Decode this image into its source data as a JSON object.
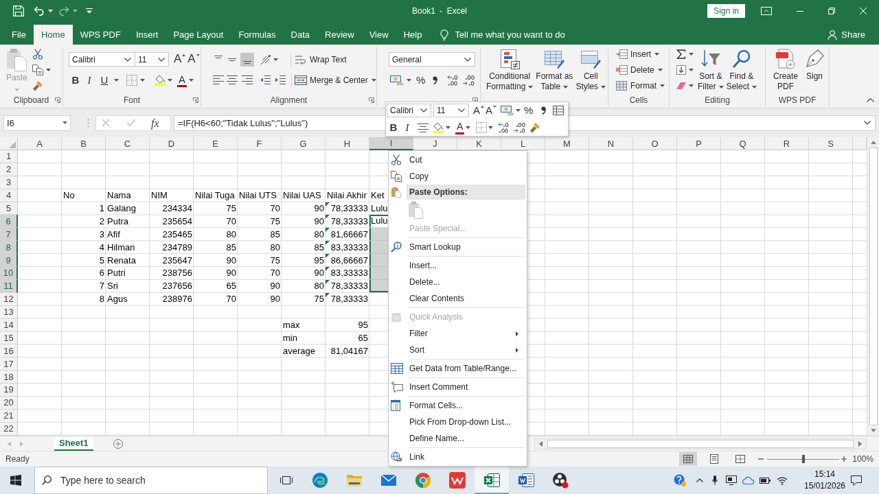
{
  "title_bar": {
    "quick_access": [
      {
        "disabled": false
      },
      {
        "disabled": false
      },
      {
        "disabled": true
      },
      {
        "disabled": false
      }
    ],
    "title": "Book1 - Excel",
    "sign_in": "Sign in"
  },
  "ribbon_tabs": [
    {
      "label": "File",
      "selected": false
    },
    {
      "label": "Home",
      "selected": true
    },
    {
      "label": "WPS PDF",
      "selected": false
    },
    {
      "label": "Insert",
      "selected": false
    },
    {
      "label": "Page Layout",
      "selected": false
    },
    {
      "label": "Formulas",
      "selected": false
    },
    {
      "label": "Data",
      "selected": false
    },
    {
      "label": "Review",
      "selected": false
    },
    {
      "label": "View",
      "selected": false
    },
    {
      "label": "Help",
      "selected": false
    }
  ],
  "tell_me": "Tell me what you want to do",
  "share": "Share",
  "clipboard": {
    "label": "Clipboard",
    "paste": "Paste",
    "paste_disabled": true
  },
  "font": {
    "label": "Font",
    "name": "Calibri",
    "size": "11",
    "grow": "A",
    "shrink": "A",
    "styles": [
      "B",
      "I",
      "U"
    ],
    "font_color": "A"
  },
  "alignment": {
    "label": "Alignment",
    "vertical": [
      {
        "selected": false
      },
      {
        "selected": false
      },
      {
        "selected": true
      }
    ],
    "wrap_text": "Wrap Text",
    "merge": "Merge & Center"
  },
  "number": {
    "format": "General",
    "percent": "%"
  },
  "styles": {
    "buttons": [
      "Conditional Formatting",
      "Format as Table",
      "Cell Styles"
    ]
  },
  "cells": {
    "label": "Cells",
    "buttons": [
      "Insert",
      "Delete",
      "Format"
    ]
  },
  "editing": {
    "label": "Editing",
    "buttons": [
      "Sort & Filter",
      "Find & Select"
    ]
  },
  "wps_pdf": {
    "label": "WPS PDF",
    "buttons": [
      "Create PDF",
      "Sign"
    ]
  },
  "formula_bar": {
    "name_box": "I6",
    "fx": "fx",
    "formula": "=IF(H6<60;\"Tidak Lulus\";\"Lulus\")"
  },
  "mini_toolbar": {
    "name": "Calibri",
    "size": "11",
    "grow": "A",
    "shrink": "A",
    "percent": "%",
    "styles": [
      "B",
      "I"
    ],
    "font_color": "A"
  },
  "sheet": {
    "columns": [
      {
        "label": "A",
        "selected": false
      },
      {
        "label": "B",
        "selected": false
      },
      {
        "label": "C",
        "selected": false
      },
      {
        "label": "D",
        "selected": false
      },
      {
        "label": "E",
        "selected": false
      },
      {
        "label": "F",
        "selected": false
      },
      {
        "label": "G",
        "selected": false
      },
      {
        "label": "H",
        "selected": false
      },
      {
        "label": "I",
        "selected": true
      },
      {
        "label": "J",
        "selected": false
      },
      {
        "label": "K",
        "selected": false
      },
      {
        "label": "L",
        "selected": false
      },
      {
        "label": "M",
        "selected": false
      },
      {
        "label": "N",
        "selected": false
      },
      {
        "label": "O",
        "selected": false
      },
      {
        "label": "P",
        "selected": false
      },
      {
        "label": "Q",
        "selected": false
      },
      {
        "label": "R",
        "selected": false
      },
      {
        "label": "S",
        "selected": false
      }
    ],
    "rows": [
      {
        "label": "1",
        "selected": false
      },
      {
        "label": "2",
        "selected": false
      },
      {
        "label": "3",
        "selected": false
      },
      {
        "label": "4",
        "selected": false,
        "cells": [
          null,
          {
            "text": "No",
            "kind": "text",
            "flagged": false,
            "active": false
          },
          {
            "text": "Nama",
            "kind": "text",
            "flagged": false,
            "active": false
          },
          {
            "text": "NIM",
            "kind": "text",
            "flagged": false,
            "active": false
          },
          {
            "text": "Nilai Tuga",
            "kind": "text",
            "flagged": false,
            "active": false
          },
          {
            "text": "Nilai UTS",
            "kind": "text",
            "flagged": false,
            "active": false
          },
          {
            "text": "Nilai UAS",
            "kind": "text",
            "flagged": false,
            "active": false
          },
          {
            "text": "Nilai Akhir",
            "kind": "text",
            "flagged": false,
            "active": false
          },
          {
            "text": "Ket",
            "kind": "text",
            "flagged": false,
            "active": false
          }
        ]
      },
      {
        "label": "5",
        "selected": false,
        "cells": [
          null,
          {
            "text": "1",
            "kind": "number",
            "flagged": false,
            "active": false
          },
          {
            "text": "Galang",
            "kind": "text",
            "flagged": false,
            "active": false
          },
          {
            "text": "234334",
            "kind": "number",
            "flagged": false,
            "active": false
          },
          {
            "text": "75",
            "kind": "number",
            "flagged": false,
            "active": false
          },
          {
            "text": "70",
            "kind": "number",
            "flagged": false,
            "active": false
          },
          {
            "text": "90",
            "kind": "number",
            "flagged": false,
            "active": false
          },
          {
            "text": "78,33333",
            "kind": "number",
            "flagged": true,
            "active": false
          },
          {
            "text": "Lulu",
            "kind": "text",
            "flagged": false,
            "active": false
          }
        ]
      },
      {
        "label": "6",
        "selected": true,
        "cells": [
          null,
          {
            "text": "2",
            "kind": "number",
            "flagged": false,
            "active": false
          },
          {
            "text": "Putra",
            "kind": "text",
            "flagged": false,
            "active": false
          },
          {
            "text": "235654",
            "kind": "number",
            "flagged": false,
            "active": false
          },
          {
            "text": "70",
            "kind": "number",
            "flagged": false,
            "active": false
          },
          {
            "text": "75",
            "kind": "number",
            "flagged": false,
            "active": false
          },
          {
            "text": "90",
            "kind": "number",
            "flagged": false,
            "active": false
          },
          {
            "text": "78,33333",
            "kind": "number",
            "flagged": true,
            "active": false
          },
          {
            "text": "Lulu",
            "kind": "text",
            "flagged": false,
            "active": true
          }
        ]
      },
      {
        "label": "7",
        "selected": true,
        "cells": [
          null,
          {
            "text": "3",
            "kind": "number",
            "flagged": false,
            "active": false
          },
          {
            "text": "Afif",
            "kind": "text",
            "flagged": false,
            "active": false
          },
          {
            "text": "235465",
            "kind": "number",
            "flagged": false,
            "active": false
          },
          {
            "text": "80",
            "kind": "number",
            "flagged": false,
            "active": false
          },
          {
            "text": "85",
            "kind": "number",
            "flagged": false,
            "active": false
          },
          {
            "text": "80",
            "kind": "number",
            "flagged": false,
            "active": false
          },
          {
            "text": "81,66667",
            "kind": "number",
            "flagged": true,
            "active": false
          }
        ]
      },
      {
        "label": "8",
        "selected": true,
        "cells": [
          null,
          {
            "text": "4",
            "kind": "number",
            "flagged": false,
            "active": false
          },
          {
            "text": "Hilman",
            "kind": "text",
            "flagged": false,
            "active": false
          },
          {
            "text": "234789",
            "kind": "number",
            "flagged": false,
            "active": false
          },
          {
            "text": "85",
            "kind": "number",
            "flagged": false,
            "active": false
          },
          {
            "text": "80",
            "kind": "number",
            "flagged": false,
            "active": false
          },
          {
            "text": "85",
            "kind": "number",
            "flagged": false,
            "active": false
          },
          {
            "text": "83,33333",
            "kind": "number",
            "flagged": true,
            "active": false
          }
        ]
      },
      {
        "label": "9",
        "selected": true,
        "cells": [
          null,
          {
            "text": "5",
            "kind": "number",
            "flagged": false,
            "active": false
          },
          {
            "text": "Renata",
            "kind": "text",
            "flagged": false,
            "active": false
          },
          {
            "text": "235647",
            "kind": "number",
            "flagged": false,
            "active": false
          },
          {
            "text": "90",
            "kind": "number",
            "flagged": false,
            "active": false
          },
          {
            "text": "75",
            "kind": "number",
            "flagged": false,
            "active": false
          },
          {
            "text": "95",
            "kind": "number",
            "flagged": false,
            "active": false
          },
          {
            "text": "86,66667",
            "kind": "number",
            "flagged": true,
            "active": false
          }
        ]
      },
      {
        "label": "10",
        "selected": true,
        "cells": [
          null,
          {
            "text": "6",
            "kind": "number",
            "flagged": false,
            "active": false
          },
          {
            "text": "Putri",
            "kind": "text",
            "flagged": false,
            "active": false
          },
          {
            "text": "238756",
            "kind": "number",
            "flagged": false,
            "active": false
          },
          {
            "text": "90",
            "kind": "number",
            "flagged": false,
            "active": false
          },
          {
            "text": "70",
            "kind": "number",
            "flagged": false,
            "active": false
          },
          {
            "text": "90",
            "kind": "number",
            "flagged": false,
            "active": false
          },
          {
            "text": "83,33333",
            "kind": "number",
            "flagged": true,
            "active": false
          }
        ]
      },
      {
        "label": "11",
        "selected": true,
        "cells": [
          null,
          {
            "text": "7",
            "kind": "number",
            "flagged": false,
            "active": false
          },
          {
            "text": "Sri",
            "kind": "text",
            "flagged": false,
            "active": false
          },
          {
            "text": "237656",
            "kind": "number",
            "flagged": false,
            "active": false
          },
          {
            "text": "65",
            "kind": "number",
            "flagged": false,
            "active": false
          },
          {
            "text": "90",
            "kind": "number",
            "flagged": false,
            "active": false
          },
          {
            "text": "80",
            "kind": "number",
            "flagged": false,
            "active": false
          },
          {
            "text": "78,33333",
            "kind": "number",
            "flagged": true,
            "active": false
          }
        ]
      },
      {
        "label": "12",
        "selected": false,
        "cells": [
          null,
          {
            "text": "8",
            "kind": "number",
            "flagged": false,
            "active": false
          },
          {
            "text": "Agus",
            "kind": "text",
            "flagged": false,
            "active": false
          },
          {
            "text": "238976",
            "kind": "number",
            "flagged": false,
            "active": false
          },
          {
            "text": "70",
            "kind": "number",
            "flagged": false,
            "active": false
          },
          {
            "text": "90",
            "kind": "number",
            "flagged": false,
            "active": false
          },
          {
            "text": "75",
            "kind": "number",
            "flagged": false,
            "active": false
          },
          {
            "text": "78,33333",
            "kind": "number",
            "flagged": true,
            "active": false
          }
        ]
      },
      {
        "label": "13",
        "selected": false
      },
      {
        "label": "14",
        "selected": false,
        "cells": [
          null,
          null,
          null,
          null,
          null,
          null,
          {
            "text": "max",
            "kind": "text",
            "flagged": false,
            "active": false
          },
          {
            "text": "95",
            "kind": "number",
            "flagged": false,
            "active": false
          }
        ]
      },
      {
        "label": "15",
        "selected": false,
        "cells": [
          null,
          null,
          null,
          null,
          null,
          null,
          {
            "text": "min",
            "kind": "text",
            "flagged": false,
            "active": false
          },
          {
            "text": "65",
            "kind": "number",
            "flagged": false,
            "active": false
          }
        ]
      },
      {
        "label": "16",
        "selected": false,
        "cells": [
          null,
          null,
          null,
          null,
          null,
          null,
          {
            "text": "average",
            "kind": "text",
            "flagged": false,
            "active": false
          },
          {
            "text": "81,04167",
            "kind": "number",
            "flagged": false,
            "active": false
          }
        ]
      },
      {
        "label": "17",
        "selected": false
      },
      {
        "label": "18",
        "selected": false
      },
      {
        "label": "19",
        "selected": false
      },
      {
        "label": "20",
        "selected": false
      },
      {
        "label": "21",
        "selected": false
      },
      {
        "label": "22",
        "selected": false
      }
    ]
  },
  "context_menu": {
    "groups": [
      [
        {
          "kind": "command",
          "label": "Cut",
          "disabled": false,
          "submenu": false
        },
        {
          "kind": "command",
          "label": "Copy",
          "disabled": false,
          "submenu": false
        },
        {
          "kind": "header",
          "label": "Paste Options:",
          "disabled": false,
          "submenu": false
        },
        {
          "kind": "paste_options",
          "disabled": true,
          "submenu": false
        },
        {
          "kind": "command",
          "label": "Paste Special...",
          "disabled": true,
          "submenu": false
        }
      ],
      [
        {
          "kind": "command",
          "label": "Smart Lookup",
          "disabled": false,
          "submenu": false
        }
      ],
      [
        {
          "kind": "command",
          "label": "Insert...",
          "disabled": false,
          "submenu": false
        },
        {
          "kind": "command",
          "label": "Delete...",
          "disabled": false,
          "submenu": false
        },
        {
          "kind": "command",
          "label": "Clear Contents",
          "disabled": false,
          "submenu": false
        }
      ],
      [
        {
          "kind": "command",
          "label": "Quick Analysis",
          "disabled": true,
          "submenu": false
        },
        {
          "kind": "command",
          "label": "Filter",
          "disabled": false,
          "submenu": true
        },
        {
          "kind": "command",
          "label": "Sort",
          "disabled": false,
          "submenu": true
        }
      ],
      [
        {
          "kind": "command",
          "label": "Get Data from Table/Range...",
          "disabled": false,
          "submenu": false
        }
      ],
      [
        {
          "kind": "command",
          "label": "Insert Comment",
          "disabled": false,
          "submenu": false
        }
      ],
      [
        {
          "kind": "command",
          "label": "Format Cells...",
          "disabled": false,
          "submenu": false
        },
        {
          "kind": "command",
          "label": "Pick From Drop-down List...",
          "disabled": false,
          "submenu": false
        },
        {
          "kind": "command",
          "label": "Define Name...",
          "disabled": false,
          "submenu": false
        }
      ],
      [
        {
          "kind": "command",
          "label": "Link",
          "disabled": false,
          "submenu": false
        }
      ]
    ]
  },
  "sheet_tabs": [
    {
      "label": "Sheet1",
      "selected": true
    }
  ],
  "status_bar": {
    "status": "Ready",
    "views": [
      {
        "selected": true
      },
      {
        "selected": false
      },
      {
        "selected": false
      }
    ],
    "zoom": {
      "level": 0.5,
      "reading": "100%"
    }
  },
  "taskbar": {
    "search": {
      "placeholder": "Type here to search"
    },
    "apps": [
      {
        "active": false
      },
      {
        "active": false
      },
      {
        "active": false
      },
      {
        "active": false
      },
      {
        "active": false
      },
      {
        "active": true
      },
      {
        "active": false
      },
      {
        "active": false
      }
    ],
    "time": "15:14",
    "date": "15/01/2026"
  }
}
